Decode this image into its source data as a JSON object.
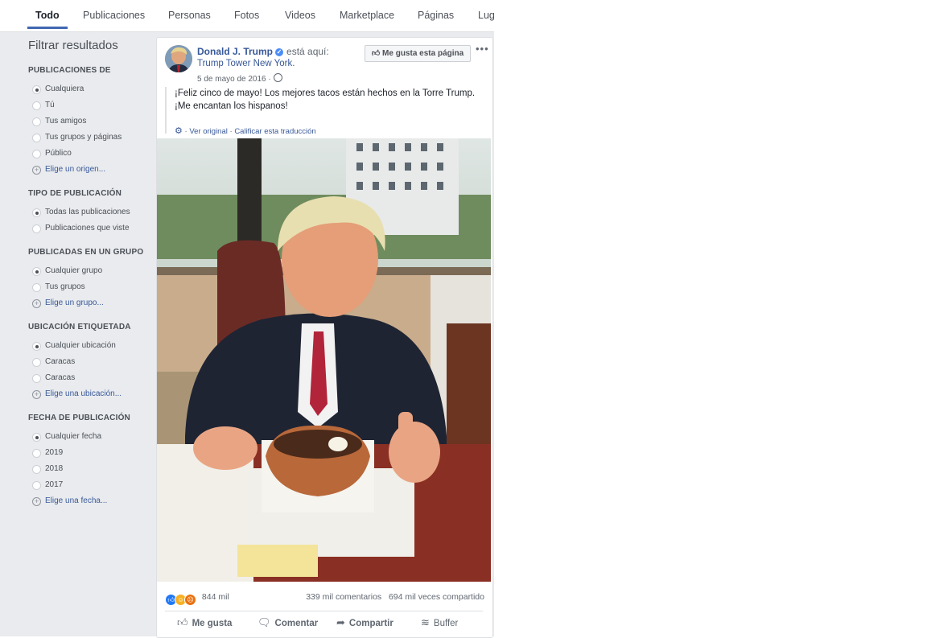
{
  "tabs": [
    "Todo",
    "Publicaciones",
    "Personas",
    "Fotos",
    "Videos",
    "Marketplace",
    "Páginas",
    "Lugares"
  ],
  "sidebar": {
    "title": "Filtrar resultados",
    "sections": [
      {
        "heading": "PUBLICACIONES DE",
        "options": [
          "Cualquiera",
          "Tú",
          "Tus amigos",
          "Tus grupos y páginas",
          "Público"
        ],
        "link": "Elige un origen..."
      },
      {
        "heading": "TIPO DE PUBLICACIÓN",
        "options": [
          "Todas las publicaciones",
          "Publicaciones que viste"
        ]
      },
      {
        "heading": "PUBLICADAS EN UN GRUPO",
        "options": [
          "Cualquier grupo",
          "Tus grupos"
        ],
        "link": "Elige un grupo..."
      },
      {
        "heading": "UBICACIÓN ETIQUETADA",
        "options": [
          "Cualquier ubicación",
          "Caracas",
          "Caracas"
        ],
        "link": "Elige una ubicación..."
      },
      {
        "heading": "FECHA DE PUBLICACIÓN",
        "options": [
          "Cualquier fecha",
          "2019",
          "2018",
          "2017"
        ],
        "link": "Elige una fecha..."
      }
    ]
  },
  "post": {
    "author": "Donald J. Trump",
    "is_here": "está aquí:",
    "place": "Trump Tower New York.",
    "date": "5 de mayo de 2016 ·",
    "like_page": "Me gusta esta página",
    "text_line1": "¡Feliz cinco de mayo! Los mejores tacos están hechos en la Torre Trump.",
    "text_line2": "¡Me encantan los hispanos!",
    "see_original": "Ver original",
    "rate_translation": "Calificar esta traducción",
    "reaction_count": "844 mil",
    "comments": "339 mil comentarios",
    "shares": "694 mil veces compartido",
    "actions": {
      "like": "Me gusta",
      "comment": "Comentar",
      "share": "Compartir",
      "buffer": "Buffer"
    }
  },
  "colors": {
    "accent": "#4267b2",
    "link": "#385898",
    "sidebar_bg": "#e9ebee"
  }
}
